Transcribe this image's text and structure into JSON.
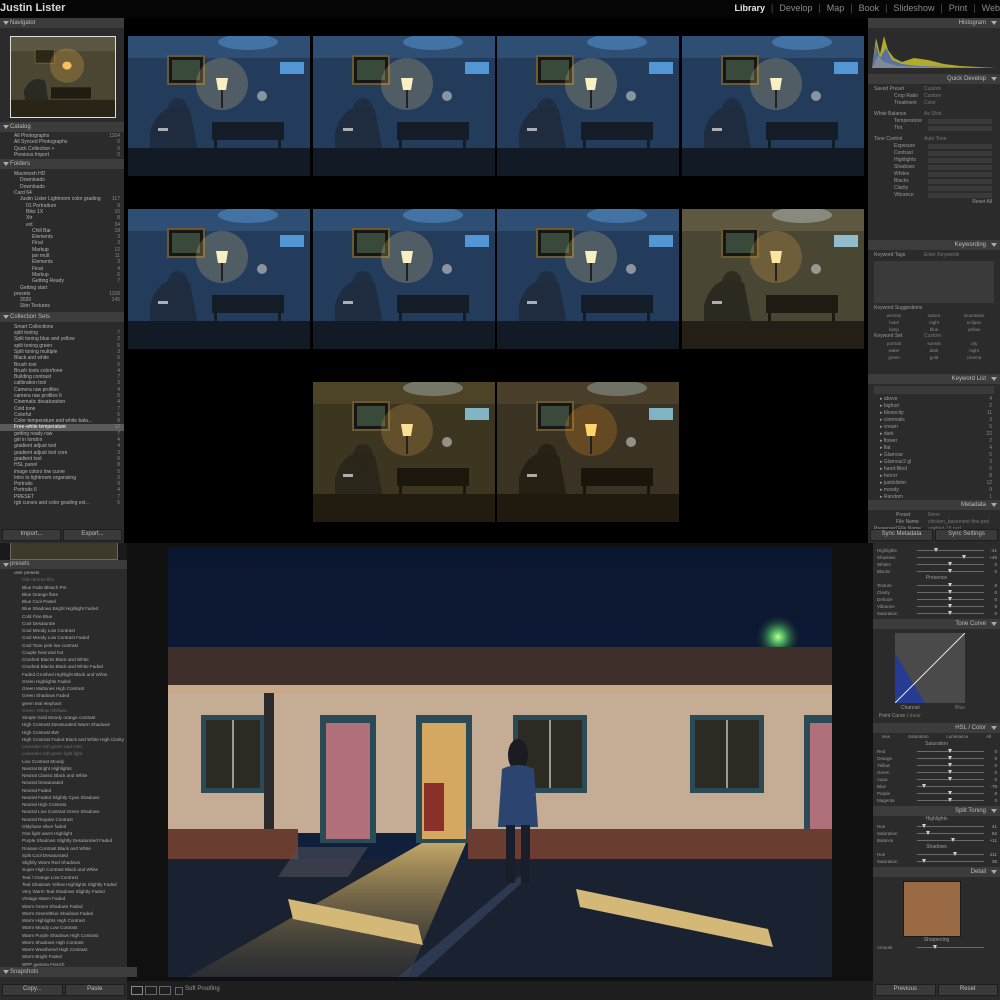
{
  "window": {
    "user": "Justin Lister",
    "modules": [
      "Library",
      "Develop",
      "Map",
      "Book",
      "Slideshow",
      "Print",
      "Web"
    ],
    "active_module": "Library"
  },
  "left_panel": {
    "navigator": "Navigator",
    "catalog": {
      "title": "Catalog",
      "items": [
        {
          "label": "All Photographs",
          "count": "1104"
        },
        {
          "label": "All Synced Photographs",
          "count": "0"
        },
        {
          "label": "Quick Collection +",
          "count": "0"
        },
        {
          "label": "Previous Import",
          "count": "0"
        }
      ]
    },
    "folders": {
      "title": "Folders",
      "items": [
        {
          "label": "Macintosh HD",
          "count": "",
          "level": 0
        },
        {
          "label": "Downloads",
          "count": "",
          "level": 1
        },
        {
          "label": "Downloads",
          "count": "",
          "level": 1
        },
        {
          "label": "Card 64",
          "count": "",
          "level": 0
        },
        {
          "label": "Justin Lister Lightroom color grading",
          "count": "117",
          "level": 1
        },
        {
          "label": "01 Portraiture",
          "count": "9",
          "level": 2
        },
        {
          "label": "Bike 1X",
          "count": "15",
          "level": 2
        },
        {
          "label": "Xtr",
          "count": "8",
          "level": 2
        },
        {
          "label": "ext",
          "count": "34",
          "level": 2
        },
        {
          "label": "Chill Bar",
          "count": "18",
          "level": 3
        },
        {
          "label": "Elements",
          "count": "3",
          "level": 4
        },
        {
          "label": "Final",
          "count": "3",
          "level": 4
        },
        {
          "label": "Markup",
          "count": "12",
          "level": 4
        },
        {
          "label": "jan mult",
          "count": "11",
          "level": 3
        },
        {
          "label": "Elements",
          "count": "3",
          "level": 4
        },
        {
          "label": "Final",
          "count": "4",
          "level": 4
        },
        {
          "label": "Markup",
          "count": "6",
          "level": 4
        },
        {
          "label": "Getting Ready",
          "count": "7",
          "level": 4
        },
        {
          "label": "Getting start",
          "count": "",
          "level": 1
        },
        {
          "label": "presets",
          "count": "1108",
          "level": 0
        },
        {
          "label": "2020",
          "count": "145",
          "level": 1
        },
        {
          "label": "Skin Textures",
          "count": "",
          "level": 1
        }
      ]
    },
    "collections": {
      "title": "Collection Sets",
      "items": [
        {
          "label": "Smart Collections",
          "count": ""
        },
        {
          "label": "split toning",
          "count": "7"
        },
        {
          "label": "Split toning blue and yellow",
          "count": "2"
        },
        {
          "label": "split toning green",
          "count": "5"
        },
        {
          "label": "Split toning multiple",
          "count": "3"
        },
        {
          "label": "Black and white",
          "count": "6"
        },
        {
          "label": "Brush tool",
          "count": "5"
        },
        {
          "label": "Brush tools color/tone",
          "count": "4"
        },
        {
          "label": "Building contrast",
          "count": "7"
        },
        {
          "label": "calibration tool",
          "count": "3"
        },
        {
          "label": "Camera raw profiles",
          "count": "4"
        },
        {
          "label": "camera raw profiles II",
          "count": "5"
        },
        {
          "label": "Cinematic desaturation",
          "count": "4"
        },
        {
          "label": "Cold tone",
          "count": "7"
        },
        {
          "label": "Colorful",
          "count": "6"
        },
        {
          "label": "Color temperature and white bala...",
          "count": "8"
        },
        {
          "label": "Free-white temperature",
          "count": "12"
        },
        {
          "label": "getting ready raw",
          "count": "7"
        },
        {
          "label": "girl in london",
          "count": "4"
        },
        {
          "label": "gradient adjust tool",
          "count": "4"
        },
        {
          "label": "gradient adjust tool core",
          "count": "3"
        },
        {
          "label": "gradient tool",
          "count": "6"
        },
        {
          "label": "HSL panel",
          "count": "8"
        },
        {
          "label": "image colors low curve",
          "count": "5"
        },
        {
          "label": "Intro to lightroom organizing",
          "count": "3"
        },
        {
          "label": "Portraits",
          "count": "9"
        },
        {
          "label": "Portraits II",
          "count": "4"
        },
        {
          "label": "PRESET",
          "count": "7"
        },
        {
          "label": "rgb curves and color grading ext...",
          "count": "6"
        }
      ],
      "selected_index": 16
    },
    "import_label": "Import...",
    "export_label": "Export..."
  },
  "right_panel": {
    "histogram": "Histogram",
    "quick_develop": {
      "title": "Quick Develop",
      "saved_preset": {
        "label": "Saved Preset",
        "value": "Custom"
      },
      "crop_ratio": {
        "label": "Crop Ratio",
        "value": "Custom"
      },
      "treatment": {
        "label": "Treatment",
        "value": "Color"
      },
      "white_balance": {
        "label": "White Balance",
        "value": "As Shot"
      },
      "wb_rows": [
        "Temperature",
        "Tint"
      ],
      "tone_control": "Tone Control",
      "tone_auto": "Auto Tone",
      "tone_rows": [
        "Exposure",
        "Contrast",
        "Highlights",
        "Shadows",
        "Whites",
        "Blacks",
        "Clarity",
        "Vibrance"
      ],
      "reset_label": "Reset All"
    },
    "keywording": {
      "title": "Keywording",
      "keyword_tags_label": "Keyword Tags",
      "keyword_tags_value": "Enter Keywords",
      "suggestions_label": "Keyword Suggestions",
      "suggestions": [
        "woman",
        "nature",
        "mountains",
        "hotel",
        "night",
        "eclipse",
        "lamp",
        "blue",
        "yellow"
      ],
      "keyword_set_label": "Keyword Set",
      "keyword_set_value": "Custom",
      "keyword_set": [
        "portrait",
        "sunset",
        "city",
        "water",
        "dark",
        "night",
        "green",
        "gold",
        "cinema"
      ]
    },
    "keyword_list": {
      "title": "Keyword List",
      "items": [
        {
          "label": "above",
          "count": "4"
        },
        {
          "label": "bigfoot",
          "count": "2"
        },
        {
          "label": "blonecity",
          "count": "11"
        },
        {
          "label": "cinematic",
          "count": "3"
        },
        {
          "label": "cream",
          "count": "5"
        },
        {
          "label": "dark",
          "count": "22"
        },
        {
          "label": "flower",
          "count": "2"
        },
        {
          "label": "flat",
          "count": "4"
        },
        {
          "label": "Glamour",
          "count": "5"
        },
        {
          "label": "Glamour2 gl",
          "count": "3"
        },
        {
          "label": "hand-filled",
          "count": "6"
        },
        {
          "label": "horror",
          "count": "8"
        },
        {
          "label": "justinlister",
          "count": "12"
        },
        {
          "label": "moody",
          "count": "9"
        },
        {
          "label": "Random",
          "count": "1"
        },
        {
          "label": "science",
          "count": "3"
        }
      ]
    },
    "metadata": {
      "title": "Metadata",
      "preset_label": "Preset",
      "preset_value": "None",
      "filename_label": "File Name",
      "filename_value": "chicken_basement-fine.psd",
      "folder_label": "Preserved File Name",
      "folder_value": "untitled-18.psd"
    },
    "sync_metadata": "Sync Metadata",
    "sync_settings": "Sync Settings"
  },
  "grid": {
    "rows": [
      [
        "blue",
        "blue",
        "blue",
        "blue"
      ],
      [
        "blue",
        "blue",
        "blue",
        "warm"
      ],
      [
        "olive",
        "warm-sel"
      ]
    ]
  },
  "develop": {
    "presets_title": "presets",
    "presets": [
      "user presets",
      "Old chrome film",
      "Blue Fade Bleach Pm",
      "Blue Orange flare",
      "Blue Cool Pastel",
      "Blue Shadows Bright Highlight Faded",
      "Cold Fine Blue",
      "Cool Desaturate",
      "Cool Moody Low Contrast",
      "Cool Moody Low Contrast Faded",
      "Cool Tone pink low contrast",
      "Couple heat and hot",
      "Crushed Blacks Black and White",
      "Crushed Blacks Black and White Faded",
      "Faded Crushed Highlight Black and White",
      "Green Highlights Faded",
      "Green Midtones High Contrast",
      "Green Shadows Faded",
      "green teal elephant",
      "Green Yellow Ishihara",
      "Simple Gold Moody orange contrast",
      "High Contrast Desaturated Warm Shadows",
      "High Contrast BW",
      "High Contrast Faded Black and White High Clarity",
      "Lavender soft green and mint",
      "Lavender soft green light light",
      "Low Contrast Moody",
      "Neutral Bright Highlights",
      "Neutral Classic Black and White",
      "Neutral Desaturated",
      "Neutral Faded",
      "Neutral Faded Slightly Cyan Shadows",
      "Neutral High Contrast",
      "Neutral Low Contrast Green Shadows",
      "Neutral Regular Contrast",
      "Oldyhaze silver faded",
      "One light warm Highlight",
      "Purple Shadows Slightly Desaturated Faded",
      "Rosane Contrast Black and White",
      "Split Cool Desaturated",
      "Slightly Warm Red Shadows",
      "Super High Contrast Black and White",
      "Teal / Orange Low Contrast",
      "Teal Shadows Yellow Highlights Slightly Faded",
      "Very Warm Teal Shadows Slightly Faded",
      "Vintage Warm Faded",
      "Warm Green Shadows Faded",
      "Warm Green/Blue Shadows Faded",
      "Warm Highlights High Contrast",
      "Warm Moody Low Contrast",
      "Warm Purple Shadows High Contrast",
      "Warm Shadows High Contrast",
      "Warm Weathered High Contrast",
      "Warm Bright Faded",
      "WPF gamma French",
      "Yellow Highlights Faded",
      "Yellow elephant",
      "Yellow Shadows Faded"
    ],
    "snapshots": "Snapshots",
    "copy_label": "Copy...",
    "paste_label": "Paste",
    "toolbar_label": "Soft Proofing",
    "basic_sliders": [
      {
        "label": "Highlights",
        "value": "-41"
      },
      {
        "label": "Shadows",
        "value": "+45"
      },
      {
        "label": "Whites",
        "value": "0"
      },
      {
        "label": "Blacks",
        "value": "0"
      }
    ],
    "presence_title": "Presence",
    "presence_sliders": [
      {
        "label": "Texture",
        "value": "0"
      },
      {
        "label": "Clarity",
        "value": "0"
      },
      {
        "label": "Dehaze",
        "value": "0"
      },
      {
        "label": "Vibrance",
        "value": "0"
      },
      {
        "label": "Saturation",
        "value": "0"
      }
    ],
    "tone_curve_title": "Tone Curve",
    "channel_label": "Channel",
    "channel_value": "Blue",
    "point_curve_label": "Point Curve",
    "point_curve_value": "Linear",
    "hsl_title": "HSL / Color",
    "hsl_tabs": [
      "Hue",
      "Saturation",
      "Luminance",
      "All"
    ],
    "hsl_sub": "Saturation",
    "hsl_sliders": [
      {
        "label": "Red",
        "value": "0"
      },
      {
        "label": "Orange",
        "value": "0"
      },
      {
        "label": "Yellow",
        "value": "0"
      },
      {
        "label": "Green",
        "value": "0"
      },
      {
        "label": "Aqua",
        "value": "0"
      },
      {
        "label": "Blue",
        "value": "-79"
      },
      {
        "label": "Purple",
        "value": "0"
      },
      {
        "label": "Magenta",
        "value": "0"
      }
    ],
    "split_title": "Split Toning",
    "split_highlights": "Highlights",
    "split_rows_a": [
      {
        "label": "Hue",
        "value": "41"
      },
      {
        "label": "Saturation",
        "value": "62"
      }
    ],
    "balance": {
      "label": "Balance",
      "value": "+11"
    },
    "split_shadows": "Shadows",
    "split_rows_b": [
      {
        "label": "Hue",
        "value": "211"
      },
      {
        "label": "Saturation",
        "value": "36"
      }
    ],
    "detail_title": "Detail",
    "sharpening": "Sharpening",
    "amount": "Amount",
    "previous_label": "Previous",
    "reset_label": "Reset"
  },
  "colors": {
    "panel_bg": "#2b2b2b",
    "header_bg": "#3c3c3c",
    "grid_bg": "#000000",
    "active_text": "#e8e8e8"
  }
}
